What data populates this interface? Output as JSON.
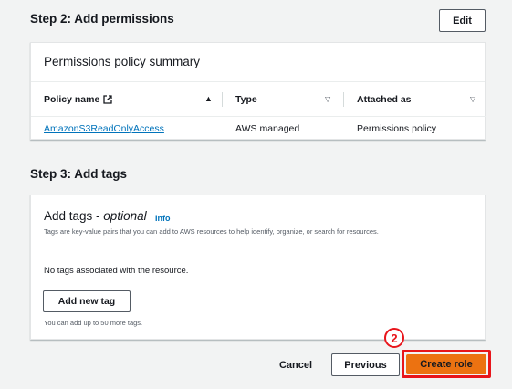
{
  "step2": {
    "title": "Step 2: Add permissions",
    "edit_label": "Edit",
    "card_title": "Permissions policy summary",
    "columns": [
      "Policy name",
      "Type",
      "Attached as"
    ],
    "rows": [
      [
        "AmazonS3ReadOnlyAccess",
        "AWS managed",
        "Permissions policy"
      ]
    ]
  },
  "step3": {
    "title": "Step 3: Add tags",
    "card_title_main": "Add tags - ",
    "card_title_optional": "optional",
    "info_label": "Info",
    "description": "Tags are key-value pairs that you can add to AWS resources to help identify, organize, or search for resources.",
    "empty_text": "No tags associated with the resource.",
    "add_tag_label": "Add new tag",
    "limit_text": "You can add up to 50 more tags."
  },
  "footer": {
    "cancel_label": "Cancel",
    "previous_label": "Previous",
    "create_label": "Create role"
  },
  "annotation": {
    "marker": "2",
    "color": "#e8151b"
  },
  "icons": {
    "policy_name_link": "external-link-icon",
    "sort_asc": "sort-ascending-icon",
    "sort_none": "sort-descending-caret-icon"
  },
  "colors": {
    "primary_button": "#ec7211",
    "link": "#0073bb",
    "background": "#f2f3f3"
  }
}
